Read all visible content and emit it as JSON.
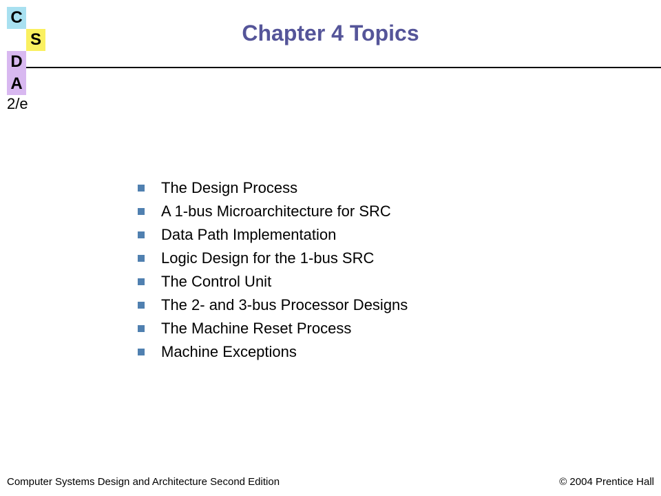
{
  "logo": {
    "c": "C",
    "s": "S",
    "d": "D",
    "a": "A",
    "edition": "2/e"
  },
  "title": "Chapter 4 Topics",
  "bullets": [
    "The Design Process",
    "A 1-bus Microarchitecture for SRC",
    "Data Path Implementation",
    "Logic Design for the 1-bus SRC",
    "The Control Unit",
    "The 2- and 3-bus Processor Designs",
    "The Machine Reset Process",
    "Machine Exceptions"
  ],
  "footer": {
    "left": "Computer Systems Design and Architecture Second Edition",
    "right": "© 2004 Prentice Hall"
  }
}
